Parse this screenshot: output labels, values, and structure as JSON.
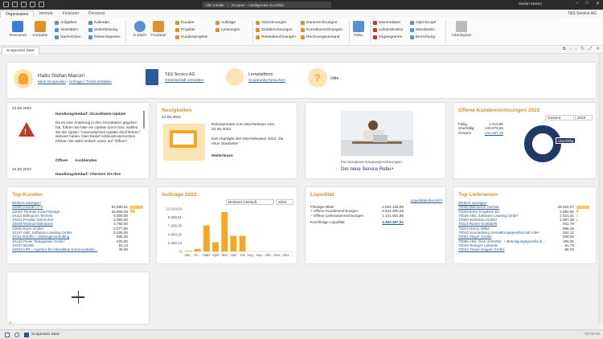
{
  "titlebar": {
    "search_scope": "Alle Inhalte",
    "search_text": "Scopevi – Intelligentes Suchfeld",
    "user": "Stefan Maron"
  },
  "menu": {
    "tabs": [
      "Organisation",
      "Vertrieb",
      "Finanzen",
      "Personal"
    ],
    "company": "T&S Service AG"
  },
  "ribbon": {
    "teamwork": "Teamwork",
    "kontakte": "Kontakte",
    "col1": [
      "Aufgaben",
      "Aktivitäten",
      "Nachrichten"
    ],
    "col2": [
      "Kalender",
      "Zeiterfassung",
      "Reisen/Spesen"
    ],
    "email": "E-Mails",
    "produkte": "Produkte",
    "col3": [
      "Kunden",
      "Projekte",
      "Kundenprojekte"
    ],
    "col4": [
      "Aufträge",
      "Leistungen"
    ],
    "col5": [
      "Abrechnungen",
      "Zeitabrechnungen",
      "Reiseabrechnungen"
    ],
    "col6": [
      "Dauerrechnungen",
      "Korrekturrechnungen",
      "Rechnungsversand"
    ],
    "rebu": "Rebu",
    "col7": [
      "Stammdaten",
      "Administration",
      "Organigramm"
    ],
    "col8": [
      "OpenScope",
      "Mandanten",
      "Einrichtung"
    ],
    "arbeitsplatz": "Arbeitsplatz"
  },
  "doctab": "Scopevisio Start",
  "head": {
    "greeting": "Hallo Stefan Maron!",
    "link1": "Mein Scopevisio",
    "link2": "Anfrage / Ticket erstellen",
    "company": "T&S Service AG",
    "company_link": "Gesellschaft verwalten",
    "learn": "Lernplattform",
    "learn_link": "Scopeunity besuchen",
    "help": "Hilfe"
  },
  "notices": {
    "date1": "24.05.2022",
    "title1": "Handlungsbedarf: Grunddaten-Update",
    "body1": "Da es eine Änderung in den Grunddaten gegeben hat, führen Sie bitte ein Update durch bzw. wählen Sie die Option \"Automatisches Update durchführen\" aktiviert haben. Dies bedarf Administratorrechten. Klicken Sie dafür einfach unten auf \"Öffnen\".",
    "open": "Öffnen",
    "hide": "Ausblenden",
    "date2": "24.05.2022",
    "title2": "Handlungsbedarf: Checken Sie Ihre"
  },
  "news": {
    "title": "Neuigkeiten",
    "date": "24.05.2022",
    "headline": "Releasenotes zum Mai-Release vom 23.05.2022",
    "text": "Das Highlight des Mai-Releases 2022: die neue Startseite!",
    "more": "Weiterlesen"
  },
  "promo": {
    "line1": "Für komplexe Eingangsrechnungen",
    "line2": "Der neue Service Rebu+"
  },
  "open_invoices": {
    "title": "Offene Kundenrechnungen 2022",
    "filter": "Gesamt",
    "year": "2022",
    "rows": [
      {
        "label": "Fällig",
        "value": "1.213,80"
      },
      {
        "label": "Überfällig",
        "value": "143.073,63"
      },
      {
        "label": "Gesamt",
        "value": "144.287,43"
      }
    ],
    "donut_label": "Überfällig",
    "faellig": 1213.8,
    "ueberfaellig": 143073.63
  },
  "top_customers": {
    "title": "Top Kunden",
    "more": "Weitere anzeigen",
    "rows": [
      {
        "name": "10000 Kanden A-Z",
        "value": "84.590,61",
        "pct": 1.0
      },
      {
        "name": "10018 Thomas Knauf Design",
        "value": "33.699,35",
        "pct": 0.4
      },
      {
        "name": "10112 Billmanns Technik",
        "value": "6.000,00",
        "pct": 0
      },
      {
        "name": "10022 Perdita Tannenhof",
        "value": "4.860,00",
        "pct": 0
      },
      {
        "name": "10039 Walraut Billmanns",
        "value": "3.750,00",
        "pct": 0
      },
      {
        "name": "12600 Eyes GmbH",
        "value": "2.077,50",
        "pct": 0
      },
      {
        "name": "10137 ABC Software Leasing GmbH",
        "value": "2.026,00",
        "pct": 0
      },
      {
        "name": "10111 Eduffm – Bildungsconsulting",
        "value": "608,40",
        "pct": 0
      },
      {
        "name": "10132 Pieler Textagentur GmbH",
        "value": "225,00",
        "pct": 0
      },
      {
        "name": "10037 BCME",
        "value": "94,13",
        "pct": 0
      },
      {
        "name": "10033 InfR – Agentur für interaktive Kommunikatio...",
        "value": "49,00",
        "pct": 0
      }
    ]
  },
  "orders": {
    "title": "Aufträge 2022",
    "filter": "Bestand (Verlauf)",
    "year": "2022"
  },
  "chart_data": {
    "type": "bar",
    "title": "",
    "categories": [
      "Jan...",
      "Fe...",
      "März",
      "April",
      "Mai",
      "Juni",
      "Juli",
      "Aug...",
      "Sep...",
      "Okt...",
      "Nov...",
      "Dez..."
    ],
    "values": [
      200,
      700,
      7300,
      2600,
      11100,
      4400,
      4400,
      0,
      0,
      0,
      0,
      0
    ],
    "yticks": [
      "12.010,64",
      "9.608,51",
      "7.206,38",
      "4.804,26",
      "2.402,13",
      "0"
    ],
    "ylim": [
      0,
      12010.64
    ]
  },
  "liquidity": {
    "title": "Liquidität",
    "link": "Liquiditätsübersicht",
    "rows": [
      {
        "label": "Flüssige Mittel",
        "value": "2.552.128,85"
      },
      {
        "label": "+ Offene Kundenrechnungen",
        "value": "2.942.300,46"
      },
      {
        "label": "– Offene Lieferantenrechnungen",
        "value": "1.101.061,80"
      }
    ],
    "total_label": "Kurzfristige Liquidität",
    "total_value": "4.393.367,51"
  },
  "top_suppliers": {
    "title": "Top Lieferanten",
    "more": "Weitere anzeigen",
    "rows": [
      {
        "name": "70008 Billmanns Technik",
        "value": "28.022,07",
        "pct": 1.0
      },
      {
        "name": "70063 Esko-Graphics BV",
        "value": "3.884,56",
        "pct": 0.14
      },
      {
        "name": "70026 ABC Software Leasing GmbH",
        "value": "2.521,01",
        "pct": 0.09
      },
      {
        "name": "70000 Wohnbau GmbH",
        "value": "1.687,39",
        "pct": 0.06
      },
      {
        "name": "70114 Rainer Goebbels",
        "value": "811,78",
        "pct": 0
      },
      {
        "name": "70074 Henry Wilke",
        "value": "696,15",
        "pct": 0
      },
      {
        "name": "70043 Sonnenberg Verwaltungsgesellschaft mbH",
        "value": "252,12",
        "pct": 0
      },
      {
        "name": "70001 Mayer GmbH",
        "value": "200,00",
        "pct": 0
      },
      {
        "name": "70095 ABC Glas Vertriebs- + Beteiligungsgesellsch...",
        "value": "190,35",
        "pct": 0
      },
      {
        "name": "70010 Textiges Lektorat",
        "value": "81,78",
        "pct": 0
      },
      {
        "name": "70024 Travel Hopper GmbH",
        "value": "60,00",
        "pct": 0
      }
    ]
  },
  "statusbar": {
    "tab": "Scopevisio Start",
    "time": "00:00:00"
  },
  "colors": {
    "accent": "#e0912f",
    "navy": "#1f3a66",
    "bar": "#f6a623",
    "link": "#2b5a8a"
  }
}
